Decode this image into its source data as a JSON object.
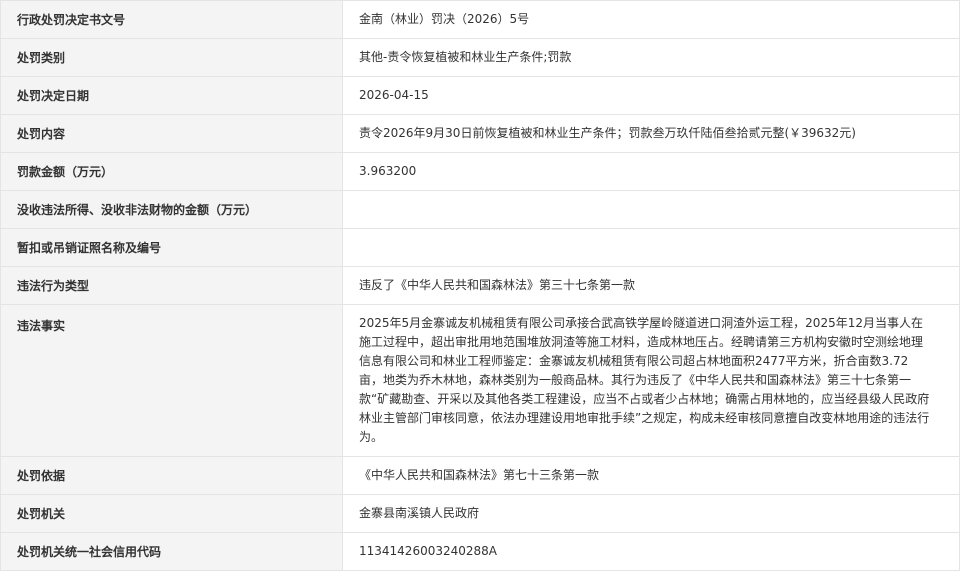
{
  "rows": [
    {
      "label": "行政处罚决定书文号",
      "value": "金南（林业）罚决（2026）5号"
    },
    {
      "label": "处罚类别",
      "value": "其他-责令恢复植被和林业生产条件;罚款"
    },
    {
      "label": "处罚决定日期",
      "value": "2026-04-15"
    },
    {
      "label": "处罚内容",
      "value": "责令2026年9月30日前恢复植被和林业生产条件；罚款叁万玖仟陆佰叁拾贰元整(￥39632元)"
    },
    {
      "label": "罚款金额（万元）",
      "value": "3.963200"
    },
    {
      "label": "没收违法所得、没收非法财物的金额（万元）",
      "value": ""
    },
    {
      "label": "暂扣或吊销证照名称及编号",
      "value": ""
    },
    {
      "label": "违法行为类型",
      "value": "违反了《中华人民共和国森林法》第三十七条第一款"
    },
    {
      "label": "违法事实",
      "value": "2025年5月金寨诚友机械租赁有限公司承接合武高铁学屋岭隧道进口洞渣外运工程，2025年12月当事人在施工过程中，超出审批用地范围堆放洞渣等施工材料，造成林地压占。经聘请第三方机构安徽时空测绘地理信息有限公司和林业工程师鉴定：金寨诚友机械租赁有限公司超占林地面积2477平方米，折合亩数3.72亩，地类为乔木林地，森林类别为一般商品林。其行为违反了《中华人民共和国森林法》第三十七条第一款“矿藏勘查、开采以及其他各类工程建设，应当不占或者少占林地；确需占用林地的，应当经县级人民政府林业主管部门审核同意，依法办理建设用地审批手续”之规定，构成未经审核同意擅自改变林地用途的违法行为。"
    },
    {
      "label": "处罚依据",
      "value": "《中华人民共和国森林法》第七十三条第一款"
    },
    {
      "label": "处罚机关",
      "value": "金寨县南溪镇人民政府"
    },
    {
      "label": "处罚机关统一社会信用代码",
      "value": "11341426003240288A"
    }
  ]
}
